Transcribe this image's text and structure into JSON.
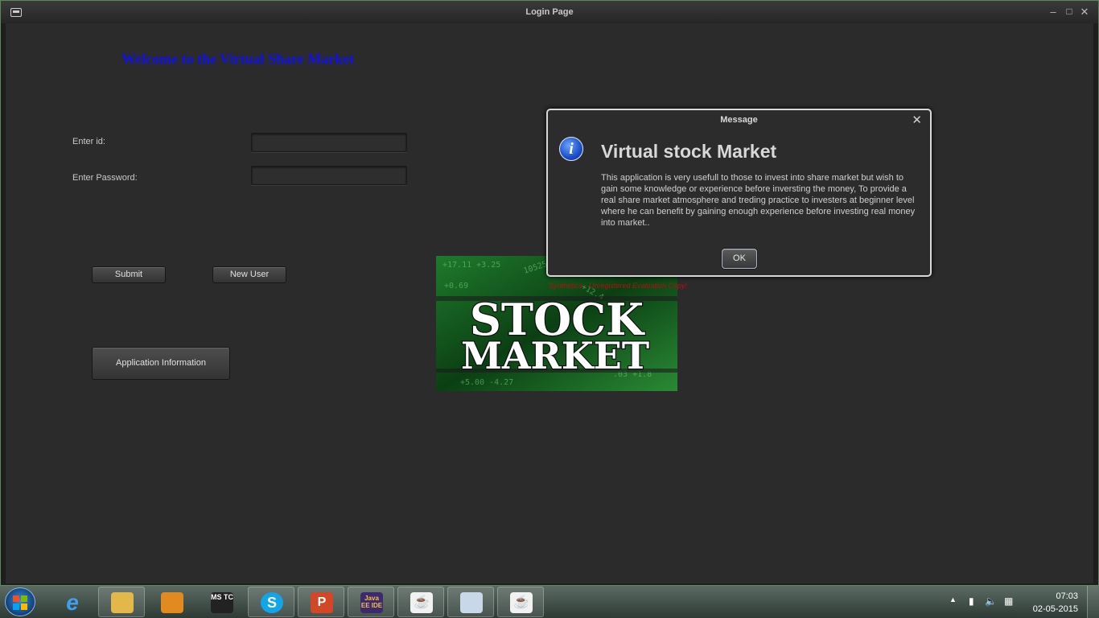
{
  "window": {
    "title": "Login Page"
  },
  "main": {
    "welcome": "Welcome to the Virtual Share Market",
    "id_label": "Enter id:",
    "password_label": "Enter Password:",
    "id_value": "",
    "password_value": "",
    "submit_label": "Submit",
    "new_user_label": "New User",
    "app_info_label": "Application Information",
    "image_text_line1": "STOCK",
    "image_text_line2": "MARKET",
    "watermark": "Synthetica - Unregistered Evaluation Copy!"
  },
  "dialog": {
    "title": "Message",
    "heading": "Virtual stock Market",
    "body": "This application is very usefull to those to invest into share market but wish to gain some knowledge or experience before inversting the money, To provide a real share market atmosphere and treding practice to investers at beginner level where he can benefit by gaining enough experience before investing real money into market..",
    "ok_label": "OK"
  },
  "taskbar": {
    "items": [
      {
        "icon": "internet-explorer-icon",
        "label": "e"
      },
      {
        "icon": "file-explorer-icon",
        "label": ""
      },
      {
        "icon": "media-player-icon",
        "label": ""
      },
      {
        "icon": "ms-tc-icon",
        "label": "MS TC"
      },
      {
        "icon": "skype-icon",
        "label": "S"
      },
      {
        "icon": "powerpoint-icon",
        "label": "P"
      },
      {
        "icon": "java-ee-ide-icon",
        "label": "Java EE IDE"
      },
      {
        "icon": "java-icon",
        "label": "☕"
      },
      {
        "icon": "paint-icon",
        "label": ""
      },
      {
        "icon": "java-icon",
        "label": "☕"
      }
    ],
    "clock_time": "07:03",
    "clock_date": "02-05-2015"
  }
}
